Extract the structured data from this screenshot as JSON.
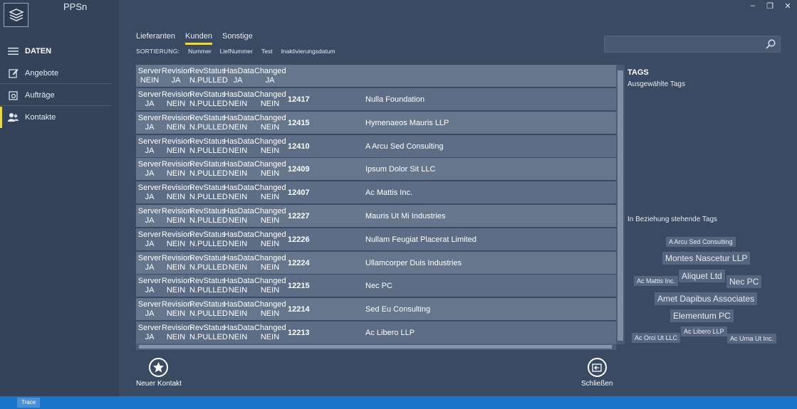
{
  "app": {
    "title": "PPSn"
  },
  "sidebar": {
    "header": "DATEN",
    "items": [
      {
        "label": "Angebote",
        "icon": "edit-icon"
      },
      {
        "label": "Aufträge",
        "icon": "order-icon"
      },
      {
        "label": "Kontakte",
        "icon": "contacts-icon",
        "active": true
      }
    ]
  },
  "tabs": [
    {
      "label": "Lieferanten",
      "active": false
    },
    {
      "label": "Kunden",
      "active": true
    },
    {
      "label": "Sonstige",
      "active": false
    }
  ],
  "sort": {
    "label": "SORTIERUNG:",
    "options": [
      "Nummer",
      "LiefNummer",
      "Test",
      "Inaktivierungsdatum"
    ]
  },
  "search": {
    "value": "",
    "placeholder": ""
  },
  "grid": {
    "columns": [
      "Server",
      "Revision",
      "RevStatus",
      "HasData",
      "Changed"
    ],
    "header_row": {
      "server": "NEIN",
      "revision": "JA",
      "revstatus": "N.PULLED",
      "hasdata": "JA",
      "changed": "JA"
    },
    "rows": [
      {
        "server": "JA",
        "revision": "NEIN",
        "revstatus": "N.PULLED",
        "hasdata": "NEIN",
        "changed": "NEIN",
        "number": "12417",
        "name": "Nulla Foundation"
      },
      {
        "server": "JA",
        "revision": "NEIN",
        "revstatus": "N.PULLED",
        "hasdata": "NEIN",
        "changed": "NEIN",
        "number": "12415",
        "name": "Hymenaeos Mauris LLP"
      },
      {
        "server": "JA",
        "revision": "NEIN",
        "revstatus": "N.PULLED",
        "hasdata": "NEIN",
        "changed": "NEIN",
        "number": "12410",
        "name": "A Arcu Sed Consulting"
      },
      {
        "server": "JA",
        "revision": "NEIN",
        "revstatus": "N.PULLED",
        "hasdata": "NEIN",
        "changed": "NEIN",
        "number": "12409",
        "name": "Ipsum Dolor Sit LLC"
      },
      {
        "server": "JA",
        "revision": "NEIN",
        "revstatus": "N.PULLED",
        "hasdata": "NEIN",
        "changed": "NEIN",
        "number": "12407",
        "name": "Ac Mattis Inc."
      },
      {
        "server": "JA",
        "revision": "NEIN",
        "revstatus": "N.PULLED",
        "hasdata": "NEIN",
        "changed": "NEIN",
        "number": "12227",
        "name": "Mauris Ut Mi Industries"
      },
      {
        "server": "JA",
        "revision": "NEIN",
        "revstatus": "N.PULLED",
        "hasdata": "NEIN",
        "changed": "NEIN",
        "number": "12226",
        "name": "Nullam Feugiat Placerat Limited"
      },
      {
        "server": "JA",
        "revision": "NEIN",
        "revstatus": "N.PULLED",
        "hasdata": "NEIN",
        "changed": "NEIN",
        "number": "12224",
        "name": "Ullamcorper Duis Industries"
      },
      {
        "server": "JA",
        "revision": "NEIN",
        "revstatus": "N.PULLED",
        "hasdata": "NEIN",
        "changed": "NEIN",
        "number": "12215",
        "name": "Nec PC"
      },
      {
        "server": "JA",
        "revision": "NEIN",
        "revstatus": "N.PULLED",
        "hasdata": "NEIN",
        "changed": "NEIN",
        "number": "12214",
        "name": "Sed Eu Consulting"
      },
      {
        "server": "JA",
        "revision": "NEIN",
        "revstatus": "N.PULLED",
        "hasdata": "NEIN",
        "changed": "NEIN",
        "number": "12213",
        "name": "Ac Libero LLP"
      }
    ]
  },
  "tags": {
    "title": "TAGS",
    "selected_label": "Ausgewählte Tags",
    "related_label": "In Beziehung stehende Tags",
    "related": [
      "A Arcu Sed Consulting",
      "Montes Nascetur LLP",
      "Ac Mattis Inc.",
      "Aliquet Ltd",
      "Nec PC",
      "Amet Dapibus Associates",
      "Elementum PC",
      "Ac Orci Ut LLC",
      "Ac Libero LLP",
      "Ac Urna Ut Inc."
    ]
  },
  "actions": {
    "new_contact": "Neuer Kontakt",
    "close": "Schließen"
  },
  "statusbar": {
    "trace": "Trace"
  },
  "colors": {
    "accent": "#e9d84a",
    "background": "#3a4a63",
    "statusbar": "#1a74c9"
  }
}
